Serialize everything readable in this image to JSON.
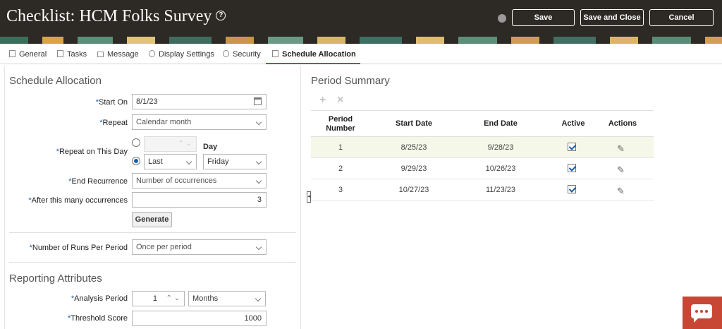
{
  "header": {
    "title": "Checklist: HCM Folks Survey",
    "help_icon": "?",
    "save": "Save",
    "save_close": "Save and Close",
    "cancel": "Cancel"
  },
  "tabs": [
    {
      "label": "General",
      "icon": "document-icon"
    },
    {
      "label": "Tasks",
      "icon": "clipboard-icon"
    },
    {
      "label": "Message",
      "icon": "message-icon"
    },
    {
      "label": "Display Settings",
      "icon": "display-settings-icon"
    },
    {
      "label": "Security",
      "icon": "people-icon"
    },
    {
      "label": "Schedule Allocation",
      "icon": "calendar-icon",
      "active": true
    }
  ],
  "schedule": {
    "heading": "Schedule Allocation",
    "start_on_label": "Start On",
    "start_on_value": "8/1/23",
    "repeat_label": "Repeat",
    "repeat_value": "Calendar month",
    "repeat_day_label": "Repeat on This Day",
    "day_label": "Day",
    "last_value": "Last",
    "weekday_value": "Friday",
    "end_recurrence_label": "End Recurrence",
    "end_recurrence_value": "Number of occurrences",
    "occurrences_label": "After this many occurrences",
    "occurrences_value": "3",
    "generate": "Generate",
    "runs_label": "Number of Runs Per Period",
    "runs_value": "Once per period"
  },
  "reporting": {
    "heading": "Reporting Attributes",
    "analysis_label": "Analysis Period",
    "analysis_value": "1",
    "analysis_unit": "Months",
    "threshold_label": "Threshold Score",
    "threshold_value": "1000"
  },
  "summary": {
    "heading": "Period Summary",
    "columns": [
      "Period Number",
      "Start Date",
      "End Date",
      "Active",
      "Actions"
    ],
    "col_period_1": "Period",
    "col_period_2": "Number",
    "rows": [
      {
        "period": "1",
        "start": "8/25/23",
        "end": "9/28/23",
        "active": true
      },
      {
        "period": "2",
        "start": "9/29/23",
        "end": "10/26/23",
        "active": true
      },
      {
        "period": "3",
        "start": "10/27/23",
        "end": "11/23/23",
        "active": true
      }
    ]
  },
  "colors": {
    "header_bg": "#2d2a26",
    "accent_green": "#3f7d3f",
    "link_blue": "#1a5ea8",
    "chat_red": "#c74634",
    "selected_row": "#f5f7e8"
  }
}
